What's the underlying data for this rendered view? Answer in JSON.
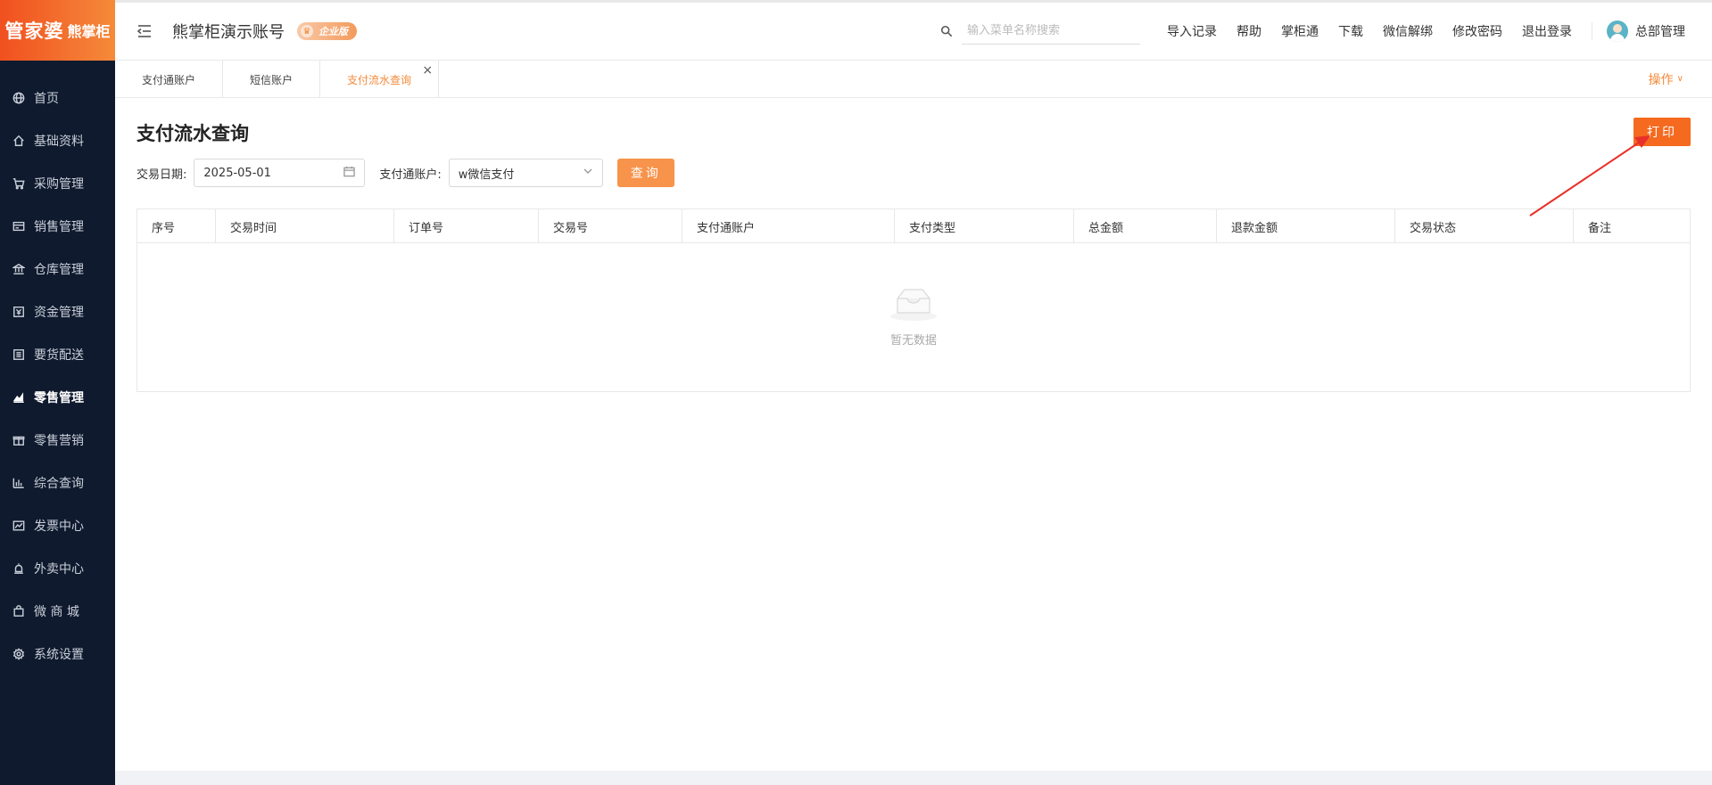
{
  "sidebar": {
    "logo_main": "管家婆",
    "logo_sub": "熊掌柜",
    "items": [
      {
        "label": "首页",
        "icon": "globe-icon"
      },
      {
        "label": "基础资料",
        "icon": "home-icon"
      },
      {
        "label": "采购管理",
        "icon": "cart-icon"
      },
      {
        "label": "销售管理",
        "icon": "card-icon"
      },
      {
        "label": "仓库管理",
        "icon": "bank-icon"
      },
      {
        "label": "资金管理",
        "icon": "money-icon"
      },
      {
        "label": "要货配送",
        "icon": "list-icon"
      },
      {
        "label": "零售管理",
        "icon": "area-chart-icon"
      },
      {
        "label": "零售营销",
        "icon": "gift-icon"
      },
      {
        "label": "综合查询",
        "icon": "bar-chart-icon"
      },
      {
        "label": "发票中心",
        "icon": "line-chart-icon"
      },
      {
        "label": "外卖中心",
        "icon": "bell-icon"
      },
      {
        "label": "微 商 城",
        "icon": "bag-icon"
      },
      {
        "label": "系统设置",
        "icon": "gear-icon"
      }
    ],
    "active_index": 7
  },
  "header": {
    "account_name": "熊掌柜演示账号",
    "edition_badge": "企业版",
    "search_placeholder": "输入菜单名称搜索",
    "links": [
      "导入记录",
      "帮助",
      "掌柜通",
      "下载",
      "微信解绑",
      "修改密码",
      "退出登录"
    ],
    "user_name": "总部管理"
  },
  "tabs": {
    "items": [
      "支付通账户",
      "短信账户",
      "支付流水查询"
    ],
    "active_index": 2,
    "operations_label": "操作"
  },
  "main": {
    "title": "支付流水查询",
    "print_label": "打印",
    "filters": {
      "date_label": "交易日期:",
      "date_value": "2025-05-01",
      "account_label": "支付通账户:",
      "account_value": "w微信支付",
      "query_label": "查询"
    },
    "table": {
      "columns": [
        "序号",
        "交易时间",
        "订单号",
        "交易号",
        "支付通账户",
        "支付类型",
        "总金额",
        "退款金额",
        "交易状态",
        "备注"
      ],
      "empty_text": "暂无数据"
    }
  },
  "colors": {
    "accent": "#f58a3a",
    "primary_button": "#f56a1f",
    "sidebar_bg": "#0f1a2e",
    "annotation_arrow": "#e8302a"
  }
}
